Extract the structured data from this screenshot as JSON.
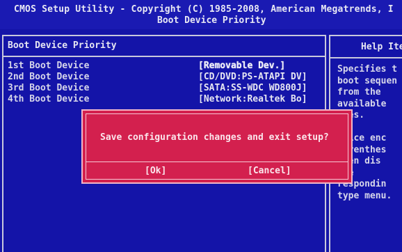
{
  "title": {
    "line1": "CMOS Setup Utility - Copyright (C) 1985-2008, American Megatrends, I",
    "line2": "Boot Device Priority"
  },
  "main": {
    "header": "Boot Device Priority",
    "items": [
      {
        "label": "1st Boot Device",
        "value": "[Removable Dev.]"
      },
      {
        "label": "2nd Boot Device",
        "value": "[CD/DVD:PS-ATAPI DV]"
      },
      {
        "label": "3rd Boot Device",
        "value": "[SATA:SS-WDC WD800J]"
      },
      {
        "label": "4th Boot Device",
        "value": "[Network:Realtek Bo]"
      }
    ]
  },
  "help": {
    "header": "Help Ite",
    "lines": [
      "Specifies t",
      "boot sequen",
      "from the",
      "available",
      "ices.",
      "",
      "evice enc",
      "parenthes",
      "been dis",
      "the",
      "respondin",
      "type menu."
    ]
  },
  "dialog": {
    "message": "Save configuration changes and exit setup?",
    "ok_label": "[Ok]",
    "cancel_label": "[Cancel]"
  }
}
